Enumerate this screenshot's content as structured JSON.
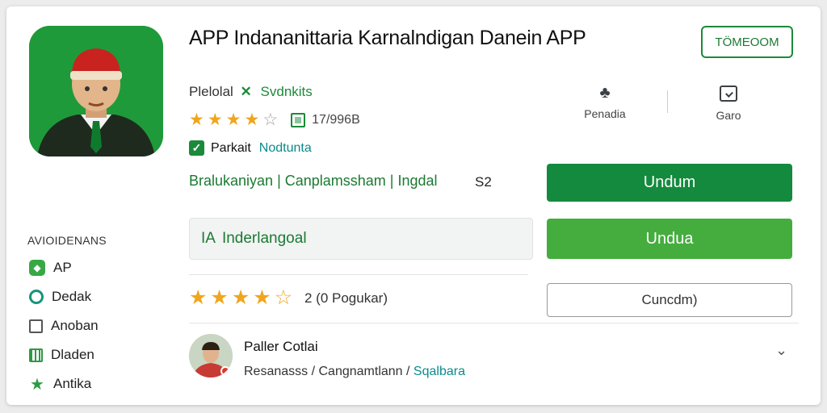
{
  "app": {
    "title": "APP Indananittaria Karnalndigan Danein APP",
    "developer": "Plelolal",
    "developer_mark": "✕",
    "developer_link": "Svdnkits",
    "rating_stars": 3.5,
    "rating_count": "17/996B",
    "badge_primary": "Parkait",
    "badge_secondary": "Nodtunta",
    "tags": "Bralukaniyan | Canplamssham | Ingdal",
    "size": "S2"
  },
  "header": {
    "top_button": "TÖMEOOM",
    "meta_left_label": "Penadia",
    "meta_right_label": "Garo"
  },
  "actions": {
    "install": "Undum",
    "install_secondary": "Undua",
    "cancel": "Cuncdm)"
  },
  "info_box": {
    "prefix": "IA",
    "text": "Inderlangoal"
  },
  "reviews_summary": {
    "stars": 4.5,
    "count_text": "2 (0 Pogukar)"
  },
  "sidebar": {
    "title": "AVIOIDENANS",
    "items": [
      {
        "label": "AP",
        "icon": "app-box-icon"
      },
      {
        "label": "Dedak",
        "icon": "circle-icon"
      },
      {
        "label": "Anoban",
        "icon": "square-icon"
      },
      {
        "label": "Dladen",
        "icon": "grid-icon"
      },
      {
        "label": "Antika",
        "icon": "star-icon"
      }
    ]
  },
  "review": {
    "author": "Paller Cotlai",
    "meta_part": "Resanasss /",
    "meta_part2": "Cangnamtlann /",
    "meta_link": "Sqalbara"
  },
  "colors": {
    "accent": "#138a3d",
    "accent_light": "#44ad3e",
    "star": "#f1a51d",
    "teal": "#0a8b8b"
  }
}
